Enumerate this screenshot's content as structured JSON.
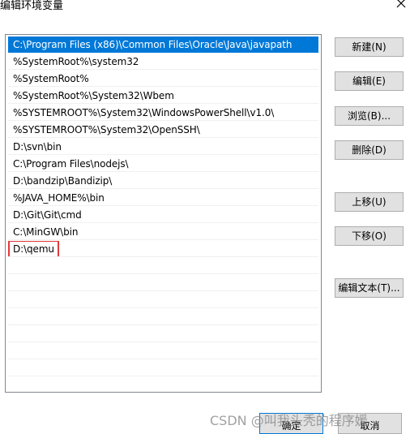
{
  "window": {
    "title": "编辑环境变量"
  },
  "list": {
    "items": [
      "C:\\Program Files (x86)\\Common Files\\Oracle\\Java\\javapath",
      "%SystemRoot%\\system32",
      "%SystemRoot%",
      "%SystemRoot%\\System32\\Wbem",
      "%SYSTEMROOT%\\System32\\WindowsPowerShell\\v1.0\\",
      "%SYSTEMROOT%\\System32\\OpenSSH\\",
      "D:\\svn\\bin",
      "C:\\Program Files\\nodejs\\",
      "D:\\bandzip\\Bandizip\\",
      "%JAVA_HOME%\\bin",
      "D:\\Git\\Git\\cmd",
      "C:\\MinGW\\bin",
      "D:\\qemu"
    ],
    "selected_index": 0,
    "highlighted_index": 12
  },
  "buttons": {
    "new": "新建(N)",
    "edit": "编辑(E)",
    "browse": "浏览(B)...",
    "delete": "删除(D)",
    "move_up": "上移(U)",
    "move_down": "下移(O)",
    "edit_text": "编辑文本(T)...",
    "ok": "确定",
    "cancel": "取消"
  },
  "watermark": "CSDN @叫我头秃的程序媛",
  "colors": {
    "selection": "#0078d7",
    "highlight_box": "#e03a3a",
    "button_face": "#e1e1e1"
  }
}
